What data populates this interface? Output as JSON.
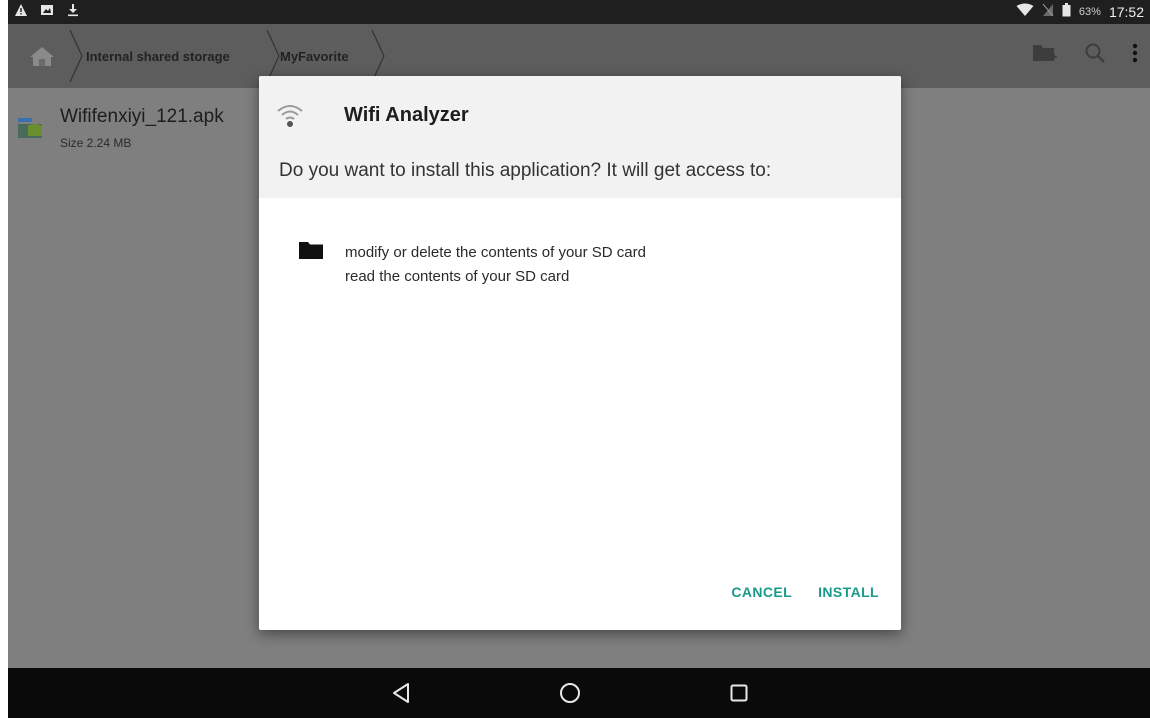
{
  "statusbar": {
    "icons_left": [
      "warning-icon",
      "image-notification-icon",
      "download-icon"
    ],
    "icons_right": [
      "wifi-icon",
      "no-sim-icon",
      "battery-icon"
    ],
    "battery": "63%",
    "time": "17:52"
  },
  "toolbar": {
    "breadcrumbs": [
      "Internal shared storage",
      "MyFavorite"
    ],
    "actions": [
      "new-folder-icon",
      "search-icon",
      "more-vert-icon"
    ]
  },
  "file": {
    "name": "Wififenxiyi_121.apk",
    "size": "Size 2.24 MB"
  },
  "dialog": {
    "app_name": "Wifi Analyzer",
    "question": "Do you want to install this application? It will get access to:",
    "permissions": [
      "modify or delete the contents of your SD card",
      "read the contents of your SD card"
    ],
    "cancel_label": "CANCEL",
    "install_label": "INSTALL"
  },
  "colors": {
    "accent": "#1a9a8b",
    "scrim": "#7f7f7f",
    "statusbar": "#1f1f1f",
    "navbar": "#0a0a0a"
  }
}
